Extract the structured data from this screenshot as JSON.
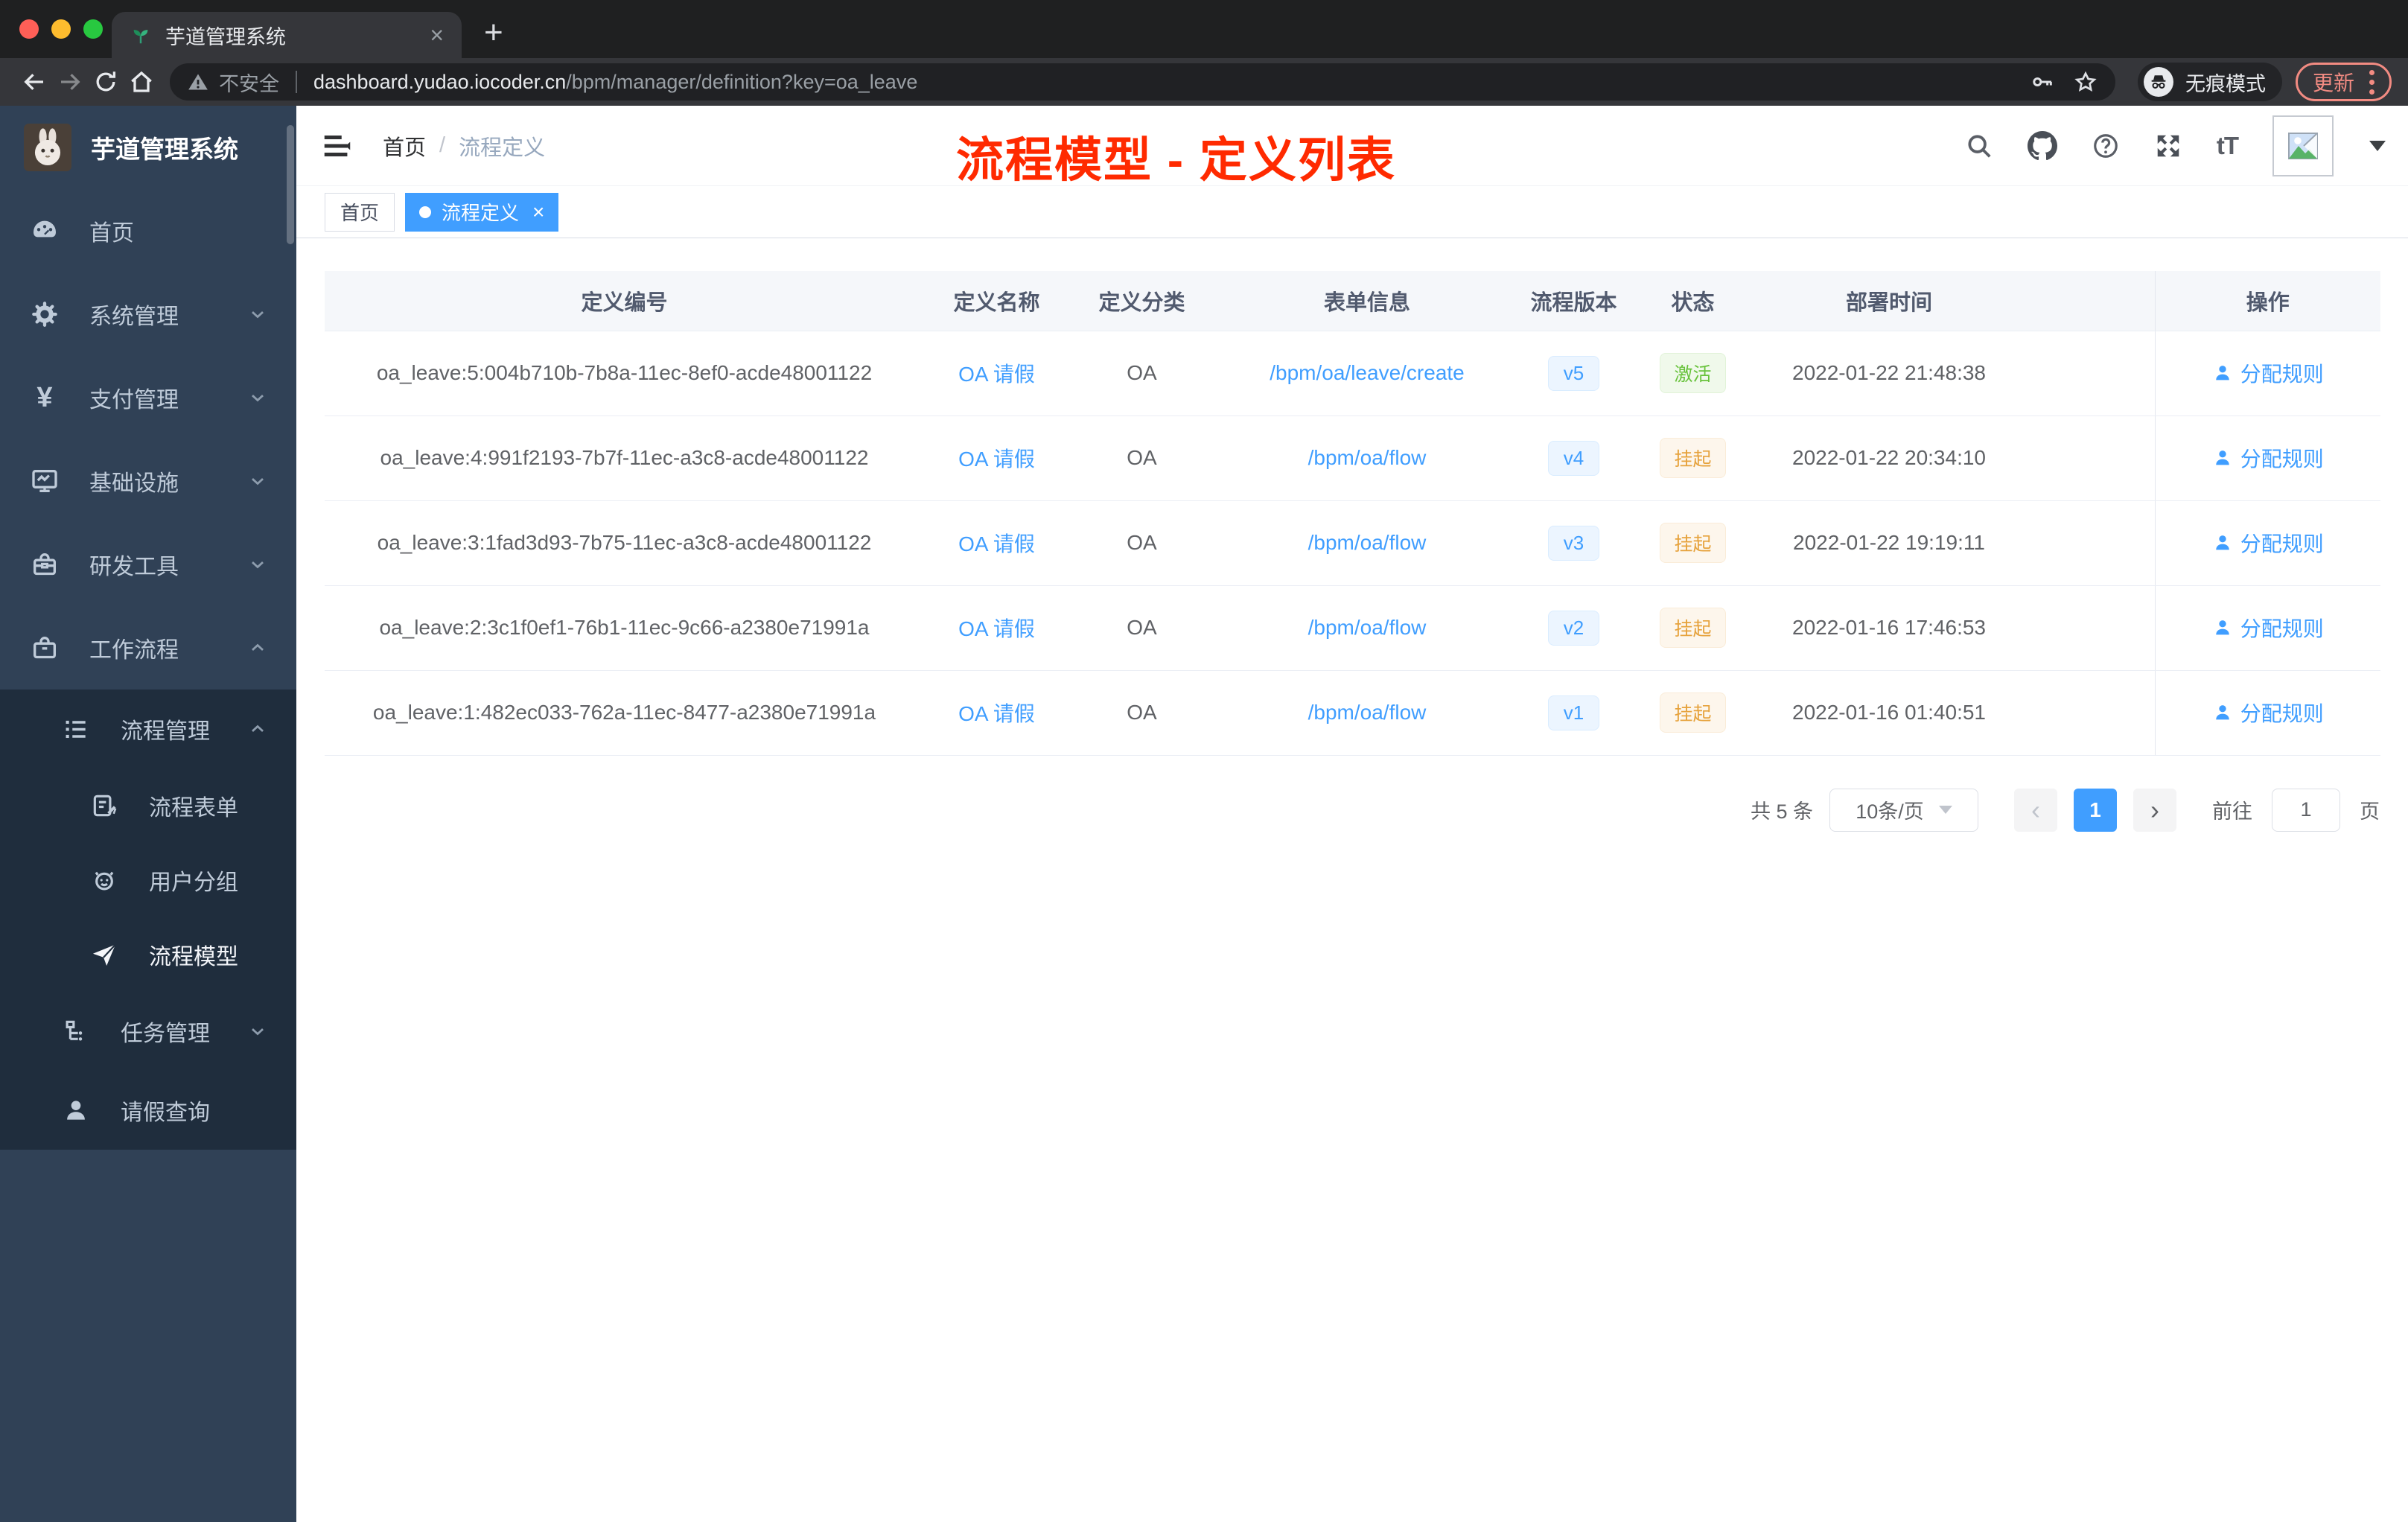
{
  "browser": {
    "tab_title": "芋道管理系统",
    "security_label": "不安全",
    "url_host": "dashboard.yudao.iocoder.cn",
    "url_path": "/bpm/manager/definition?key=oa_leave",
    "incognito_label": "无痕模式",
    "update_label": "更新"
  },
  "sidebar": {
    "app_title": "芋道管理系统",
    "items": [
      {
        "label": "首页"
      },
      {
        "label": "系统管理"
      },
      {
        "label": "支付管理"
      },
      {
        "label": "基础设施"
      },
      {
        "label": "研发工具"
      },
      {
        "label": "工作流程"
      },
      {
        "label": "流程管理"
      },
      {
        "label": "流程表单"
      },
      {
        "label": "用户分组"
      },
      {
        "label": "流程模型"
      },
      {
        "label": "任务管理"
      },
      {
        "label": "请假查询"
      }
    ]
  },
  "header": {
    "breadcrumb_home": "首页",
    "breadcrumb_current": "流程定义",
    "annotation": "流程模型 - 定义列表",
    "font_size_icon": "tT"
  },
  "tags": {
    "home": "首页",
    "active": "流程定义"
  },
  "table": {
    "columns": [
      "定义编号",
      "定义名称",
      "定义分类",
      "表单信息",
      "流程版本",
      "状态",
      "部署时间",
      "操作"
    ],
    "rows": [
      {
        "id": "oa_leave:5:004b710b-7b8a-11ec-8ef0-acde48001122",
        "name": "OA 请假",
        "category": "OA",
        "form": "/bpm/oa/leave/create",
        "version": "v5",
        "status": "激活",
        "deployed": "2022-01-22 21:48:38",
        "action": "分配规则"
      },
      {
        "id": "oa_leave:4:991f2193-7b7f-11ec-a3c8-acde48001122",
        "name": "OA 请假",
        "category": "OA",
        "form": "/bpm/oa/flow",
        "version": "v4",
        "status": "挂起",
        "deployed": "2022-01-22 20:34:10",
        "action": "分配规则"
      },
      {
        "id": "oa_leave:3:1fad3d93-7b75-11ec-a3c8-acde48001122",
        "name": "OA 请假",
        "category": "OA",
        "form": "/bpm/oa/flow",
        "version": "v3",
        "status": "挂起",
        "deployed": "2022-01-22 19:19:11",
        "action": "分配规则"
      },
      {
        "id": "oa_leave:2:3c1f0ef1-76b1-11ec-9c66-a2380e71991a",
        "name": "OA 请假",
        "category": "OA",
        "form": "/bpm/oa/flow",
        "version": "v2",
        "status": "挂起",
        "deployed": "2022-01-16 17:46:53",
        "action": "分配规则"
      },
      {
        "id": "oa_leave:1:482ec033-762a-11ec-8477-a2380e71991a",
        "name": "OA 请假",
        "category": "OA",
        "form": "/bpm/oa/flow",
        "version": "v1",
        "status": "挂起",
        "deployed": "2022-01-16 01:40:51",
        "action": "分配规则"
      }
    ]
  },
  "pagination": {
    "total": "共 5 条",
    "page_size": "10条/页",
    "current_page": "1",
    "goto_label": "前往",
    "goto_value": "1",
    "page_unit": "页"
  },
  "icons": {
    "tab_close": "×",
    "new_tab": "+",
    "tag_close": "×",
    "prev": "‹",
    "next": "›",
    "yen": "¥",
    "breadcrumb_sep": "/"
  },
  "colors": {
    "accent": "#409eff",
    "success": "#67c23a",
    "warning": "#e6a23c",
    "annotation_red": "#ff2a00",
    "sidebar_bg": "#304156",
    "submenu_bg": "#1f2d3d"
  }
}
